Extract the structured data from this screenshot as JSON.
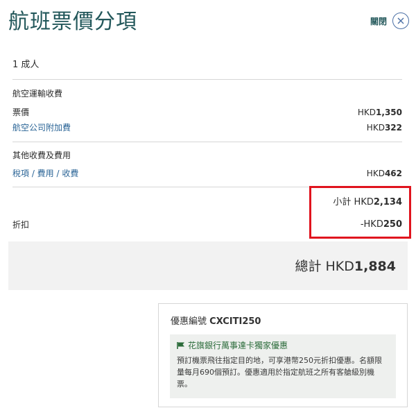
{
  "header": {
    "title": "航班票價分項",
    "close_label": "關閉"
  },
  "passenger": {
    "label": "1 成人"
  },
  "air_transport": {
    "section_label": "航空運輸收費",
    "fare": {
      "label": "票價",
      "currency": "HKD",
      "value": "1,350"
    },
    "surcharge": {
      "label": "航空公司附加費",
      "currency": "HKD",
      "value": "322"
    }
  },
  "other_charges": {
    "section_label": "其他收費及費用",
    "taxes": {
      "label": "稅項 / 費用 / 收費",
      "currency": "HKD",
      "value": "462"
    }
  },
  "subtotal": {
    "prefix": "小計 HKD",
    "value": "2,134"
  },
  "discount": {
    "label": "折扣",
    "prefix": "-HKD",
    "value": "250"
  },
  "total": {
    "prefix": "總計 HKD",
    "value": "1,884"
  },
  "promo": {
    "code_label": "優惠編號",
    "code": "CXCITI250",
    "title": "花旗銀行萬事達卡獨家優惠",
    "description": "預訂機票飛往指定目的地，可享港幣250元折扣優惠。名額限量每月690個預訂。優惠適用於指定航班之所有客艙級別機票。"
  },
  "colors": {
    "title": "#22575a",
    "link": "#2a6496",
    "highlight": "#e0141e",
    "promo_bg": "#eef0ee",
    "promo_title": "#2b6b3a"
  }
}
